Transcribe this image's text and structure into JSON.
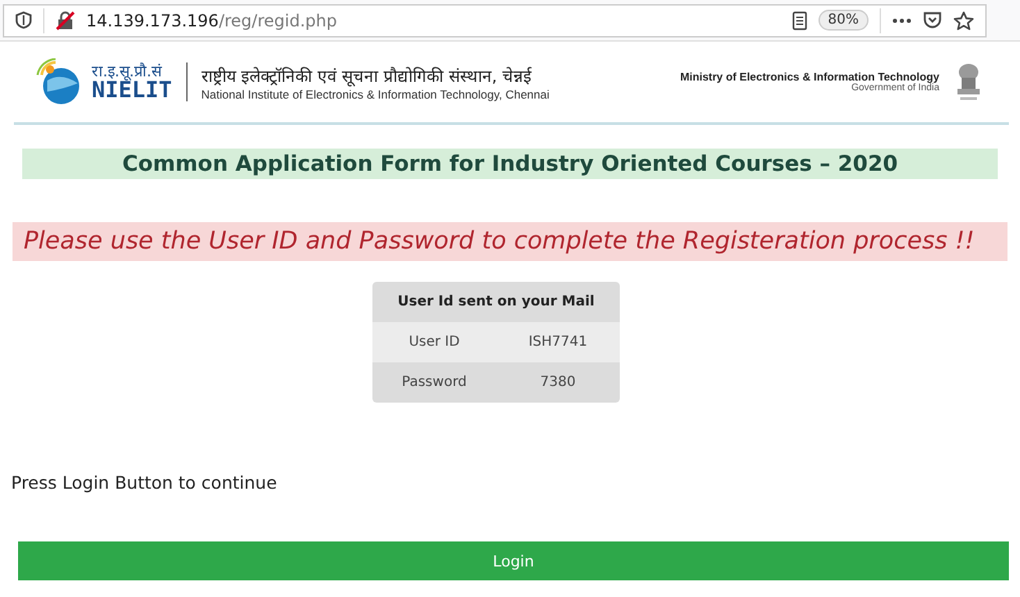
{
  "browser": {
    "url_host": "14.139.173.196",
    "url_path": "/reg/regid.php",
    "zoom": "80%"
  },
  "header": {
    "logo_hindi": "रा.इ.सू.प्रौ.सं",
    "logo_text": "NIELIT",
    "title_hindi": "राष्ट्रीय इलेक्ट्रॉनिकी एवं सूचना प्रौद्योगिकी संस्थान, चेन्नई",
    "title_english": "National Institute of Electronics & Information Technology, Chennai",
    "ministry": "Ministry of Electronics & Information Technology",
    "government": "Government of India"
  },
  "form_title": "Common Application Form for Industry Oriented Courses – 2020",
  "message": "Please use the User ID and Password to complete the Registeration process !!",
  "credentials": {
    "heading": "User Id sent on your Mail",
    "rows": [
      {
        "label": "User ID",
        "value": "ISH7741"
      },
      {
        "label": "Password",
        "value": "7380"
      }
    ]
  },
  "instruction": "Press Login Button to continue",
  "login_button": "Login"
}
